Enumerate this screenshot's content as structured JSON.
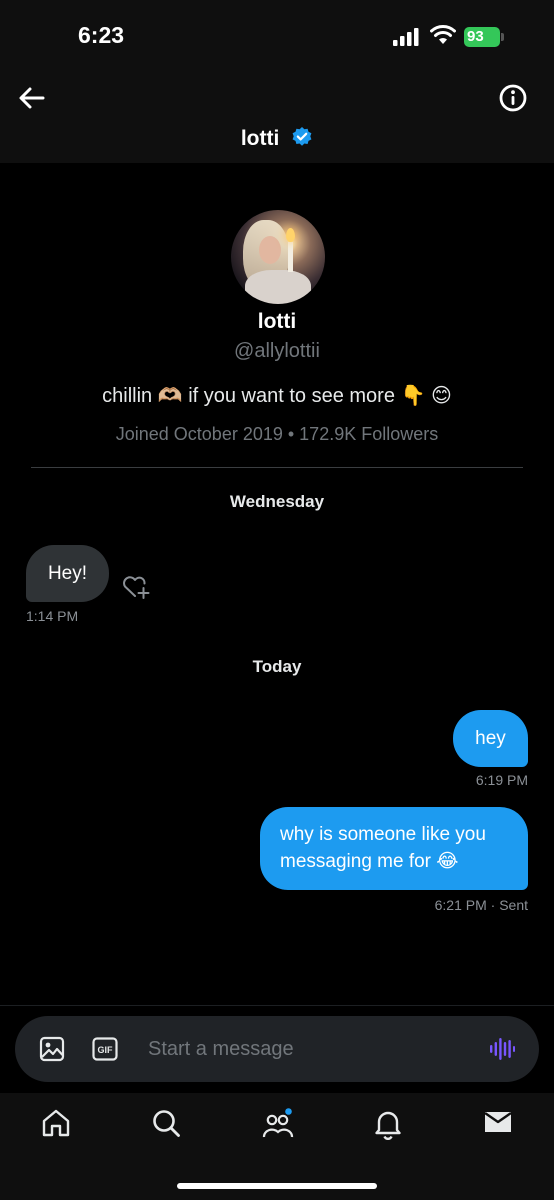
{
  "status_bar": {
    "time": "6:23",
    "battery": "93"
  },
  "header": {
    "name": "lotti",
    "verified_icon": "verified-badge-icon",
    "back_icon": "arrow-left-icon",
    "info_icon": "info-icon"
  },
  "profile": {
    "name": "lotti",
    "handle": "@allylottii",
    "bio": "chillin 🫶🏼 if you want to see more 👇 😊",
    "meta": "Joined October 2019 • 172.9K Followers"
  },
  "conversation": {
    "groups": [
      {
        "day": "Wednesday",
        "messages": [
          {
            "direction": "incoming",
            "text": "Hey!",
            "time": "1:14 PM"
          }
        ]
      },
      {
        "day": "Today",
        "messages": [
          {
            "direction": "outgoing",
            "text": "hey",
            "time": "6:19 PM"
          },
          {
            "direction": "outgoing",
            "text": "why is someone like you messaging me for 😂",
            "time": "6:21 PM",
            "status": "· Sent"
          }
        ]
      }
    ]
  },
  "composer": {
    "placeholder": "Start a message",
    "gif_label": "GIF"
  },
  "tabs": [
    "home-icon",
    "search-icon",
    "communities-icon",
    "notifications-icon",
    "messages-icon"
  ],
  "colors": {
    "accent": "#1d9bf0",
    "background": "#000000",
    "incoming_bubble": "#2f3336",
    "verified": "#1d9bf0",
    "voice": "#7856ff",
    "battery": "#34c759"
  }
}
